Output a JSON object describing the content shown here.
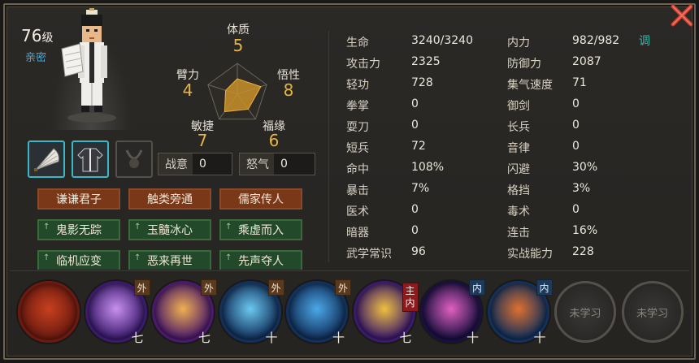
{
  "character": {
    "level_number": "76",
    "level_unit": "级",
    "relation": "亲密"
  },
  "radar": {
    "labels": [
      "体质",
      "悟性",
      "福缘",
      "敏捷",
      "臂力"
    ],
    "values": [
      "5",
      "8",
      "6",
      "7",
      "4"
    ],
    "levels": [
      5,
      8,
      6,
      7,
      4
    ],
    "max": 10
  },
  "meters": {
    "battle_intent": {
      "label": "战意",
      "value": "0"
    },
    "rage": {
      "label": "怒气",
      "value": "0"
    }
  },
  "traits": [
    {
      "label": "谦谦君子",
      "type": "orange"
    },
    {
      "label": "触类旁通",
      "type": "orange"
    },
    {
      "label": "儒家传人",
      "type": "orange"
    },
    {
      "label": "鬼影无踪",
      "type": "green"
    },
    {
      "label": "玉髓冰心",
      "type": "green"
    },
    {
      "label": "乘虚而入",
      "type": "green"
    },
    {
      "label": "临机应变",
      "type": "green"
    },
    {
      "label": "恶来再世",
      "type": "green"
    },
    {
      "label": "先声夺人",
      "type": "green"
    }
  ],
  "trait_arrow": "↑",
  "stats_left": [
    {
      "k": "生命",
      "v": "3240/3240"
    },
    {
      "k": "攻击力",
      "v": "2325"
    },
    {
      "k": "轻功",
      "v": "728"
    },
    {
      "k": "拳掌",
      "v": "0"
    },
    {
      "k": "耍刀",
      "v": "0"
    },
    {
      "k": "短兵",
      "v": "72"
    },
    {
      "k": "命中",
      "v": "108%"
    },
    {
      "k": "暴击",
      "v": "7%"
    },
    {
      "k": "医术",
      "v": "0"
    },
    {
      "k": "暗器",
      "v": "0"
    },
    {
      "k": "武学常识",
      "v": "96"
    }
  ],
  "stats_right": [
    {
      "k": "内力",
      "v": "982/982"
    },
    {
      "k": "防御力",
      "v": "2087"
    },
    {
      "k": "集气速度",
      "v": "71"
    },
    {
      "k": "御剑",
      "v": "0"
    },
    {
      "k": "长兵",
      "v": "0"
    },
    {
      "k": "音律",
      "v": "0"
    },
    {
      "k": "闪避",
      "v": "30%"
    },
    {
      "k": "格挡",
      "v": "3%"
    },
    {
      "k": "毒术",
      "v": "0"
    },
    {
      "k": "连击",
      "v": "16%"
    },
    {
      "k": "实战能力",
      "v": "228"
    }
  ],
  "tune_label": "调",
  "skills": [
    {
      "icon": "scroll-fan-skill-icon",
      "tag": "",
      "level": "",
      "colors": [
        "#6a1a10",
        "#c8401e"
      ]
    },
    {
      "icon": "wind-claw-skill-icon",
      "tag": "外",
      "level": "七",
      "colors": [
        "#3a1a6a",
        "#c890f0"
      ]
    },
    {
      "icon": "golden-fan-skill-icon",
      "tag": "外",
      "level": "七",
      "colors": [
        "#4a1a6a",
        "#f0b050"
      ]
    },
    {
      "icon": "water-fist-skill-icon",
      "tag": "外",
      "level": "十",
      "colors": [
        "#12305a",
        "#6ac8f0"
      ]
    },
    {
      "icon": "vortex-skill-icon",
      "tag": "外",
      "level": "十",
      "colors": [
        "#12305a",
        "#4aa8e8"
      ]
    },
    {
      "icon": "golden-scripture-skill-icon",
      "tag": "",
      "tag2": [
        "主",
        "内"
      ],
      "level": "七",
      "colors": [
        "#3a1a6a",
        "#f0c040"
      ]
    },
    {
      "icon": "meteor-palm-skill-icon",
      "tag": "内",
      "level": "十",
      "colors": [
        "#1a1040",
        "#e060c0"
      ]
    },
    {
      "icon": "tornado-skill-icon",
      "tag": "内",
      "level": "十",
      "colors": [
        "#12305a",
        "#e07030"
      ]
    },
    {
      "icon": "locked-skill-icon",
      "locked": "未学习"
    },
    {
      "icon": "locked-skill-icon",
      "locked": "未学习"
    }
  ]
}
